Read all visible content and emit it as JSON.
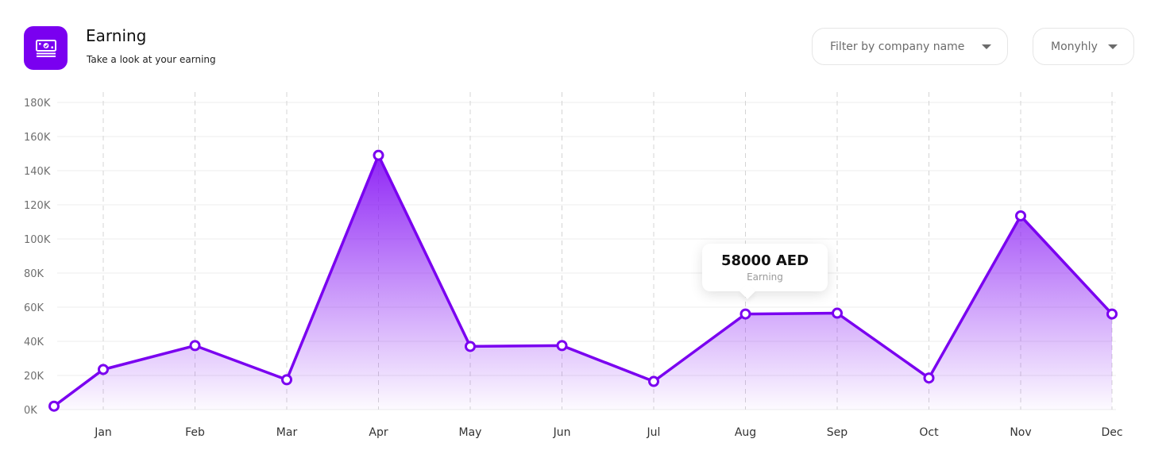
{
  "header": {
    "title": "Earning",
    "subtitle": "Take a look at your earning",
    "icon": "money-icon",
    "accent": "#7a00f0"
  },
  "filters": {
    "company_placeholder": "Filter by company name",
    "period_value": "Monyhly"
  },
  "tooltip": {
    "value": "58000 AED",
    "label": "Earning"
  },
  "chart_data": {
    "type": "area",
    "title": "",
    "xlabel": "",
    "ylabel": "",
    "ylim": [
      0,
      180000
    ],
    "yticks": [
      0,
      20000,
      40000,
      60000,
      80000,
      100000,
      120000,
      140000,
      160000,
      180000
    ],
    "ytick_labels": [
      "0K",
      "20K",
      "40K",
      "60K",
      "80K",
      "100K",
      "120K",
      "140K",
      "160K",
      "180K"
    ],
    "categories": [
      "Jan",
      "Feb",
      "Mar",
      "Apr",
      "May",
      "Jun",
      "Jul",
      "Aug",
      "Sep",
      "Oct",
      "Nov",
      "Dec"
    ],
    "series": [
      {
        "color": "#7a00f0",
        "points": [
          {
            "x": "start",
            "y": 2000
          },
          {
            "x": "Jan",
            "y": 23500
          },
          {
            "x": "Feb",
            "y": 37500
          },
          {
            "x": "Mar",
            "y": 17500
          },
          {
            "x": "Apr",
            "y": 149000
          },
          {
            "x": "May",
            "y": 37000
          },
          {
            "x": "Jun",
            "y": 37500
          },
          {
            "x": "Jul",
            "y": 16500
          },
          {
            "x": "Aug",
            "y": 56000
          },
          {
            "x": "Sep",
            "y": 56500
          },
          {
            "x": "Oct",
            "y": 18500
          },
          {
            "x": "Nov",
            "y": 113500
          },
          {
            "x": "Dec",
            "y": 56000
          }
        ]
      }
    ],
    "grid": true,
    "highlight": "Aug"
  }
}
